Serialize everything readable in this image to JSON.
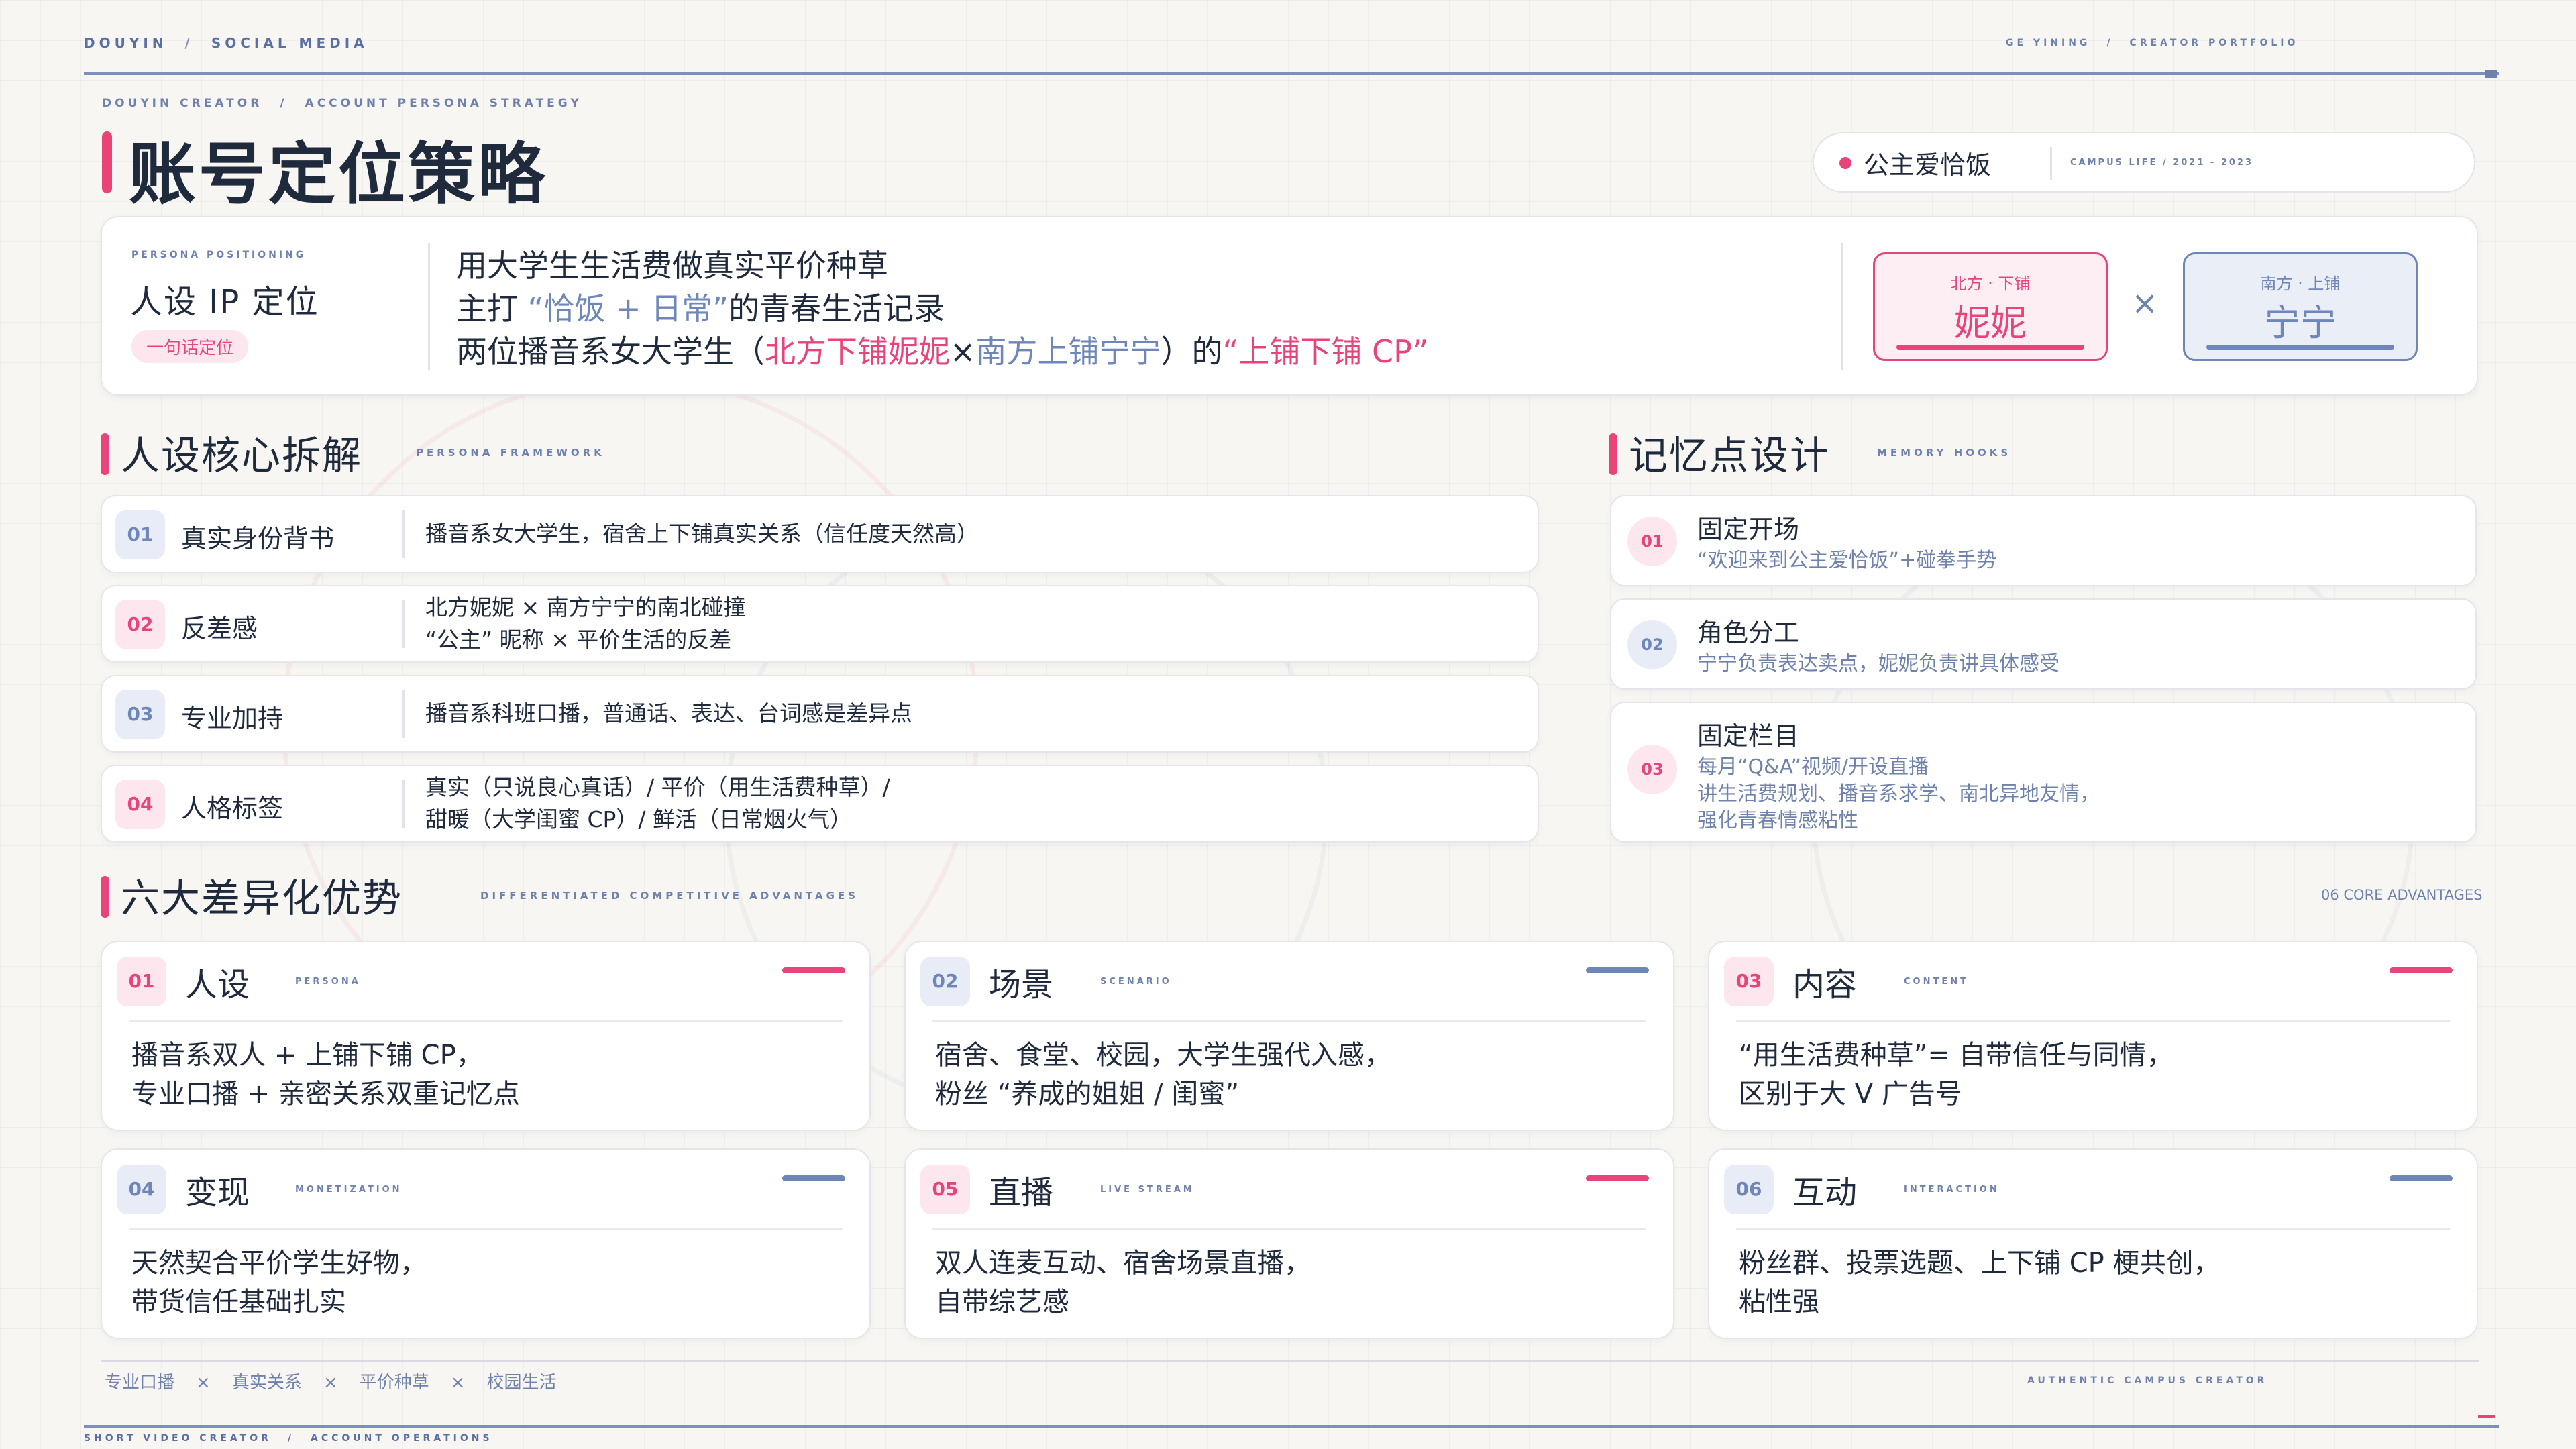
{
  "topnav": {
    "left_a": "DOUYIN",
    "left_b": "SOCIAL MEDIA",
    "right_a": "GE YINING",
    "right_b": "CREATOR PORTFOLIO",
    "sep": "/"
  },
  "crumb": {
    "a": "DOUYIN CREATOR",
    "b": "ACCOUNT PERSONA STRATEGY"
  },
  "title": "账号定位策略",
  "account": {
    "name": "公主爱恰饭",
    "meta": "CAMPUS LIFE  /  2021 - 2023"
  },
  "positioning": {
    "label_en": "PERSONA POSITIONING",
    "label_zh": "人设 IP 定位",
    "tag": "一句话定位",
    "line1": "用大学生生活费做真实平价种草",
    "line2": {
      "a": "主打 ",
      "b": "“恰饭 + 日常”",
      "c": "的青春生活记录"
    },
    "line3": {
      "a": "两位播音系女大学生（",
      "b": "北方下铺妮妮",
      "c": "×",
      "d": "南方上铺宁宁",
      "e": "）的",
      "f": "“上铺下铺 CP”"
    },
    "role_a": {
      "sub": "北方 · 下铺",
      "name": "妮妮"
    },
    "times": "×",
    "role_b": {
      "sub": "南方 · 上铺",
      "name": "宁宁"
    }
  },
  "framework": {
    "title": "人设核心拆解",
    "en": "PERSONA FRAMEWORK",
    "items": [
      {
        "num": "01",
        "name": "真实身份背书",
        "desc1": "播音系女大学生，宿舍上下铺真实关系（信任度天然高）",
        "desc2": ""
      },
      {
        "num": "02",
        "name": "反差感",
        "desc1": "北方妮妮 × 南方宁宁的南北碰撞",
        "desc2": "“公主” 昵称 × 平价生活的反差"
      },
      {
        "num": "03",
        "name": "专业加持",
        "desc1": "播音系科班口播，普通话、表达、台词感是差异点",
        "desc2": ""
      },
      {
        "num": "04",
        "name": "人格标签",
        "desc1": "真实（只说良心真话）/ 平价（用生活费种草）/",
        "desc2": "甜暖（大学闺蜜 CP）/ 鲜活（日常烟火气）"
      }
    ]
  },
  "memory": {
    "title": "记忆点设计",
    "en": "MEMORY HOOKS",
    "items": [
      {
        "num": "01",
        "title": "固定开场",
        "d1": "“欢迎来到公主爱恰饭”+碰拳手势",
        "d2": "",
        "d3": ""
      },
      {
        "num": "02",
        "title": "角色分工",
        "d1": "宁宁负责表达卖点，妮妮负责讲具体感受",
        "d2": "",
        "d3": ""
      },
      {
        "num": "03",
        "title": "固定栏目",
        "d1": "每月“Q&A”视频/开设直播",
        "d2": "讲生活费规划、播音系求学、南北异地友情，",
        "d3": "强化青春情感粘性"
      }
    ]
  },
  "advantages": {
    "title": "六大差异化优势",
    "en": "DIFFERENTIATED COMPETITIVE ADVANTAGES",
    "count": "06 CORE ADVANTAGES",
    "items": [
      {
        "num": "01",
        "zh": "人设",
        "en": "PERSONA",
        "b1": "播音系双人 + 上铺下铺 CP，",
        "b2": "专业口播 + 亲密关系双重记忆点"
      },
      {
        "num": "02",
        "zh": "场景",
        "en": "SCENARIO",
        "b1": "宿舍、食堂、校园，大学生强代入感，",
        "b2": "粉丝 “养成的姐姐 / 闺蜜”"
      },
      {
        "num": "03",
        "zh": "内容",
        "en": "CONTENT",
        "b1": "“用生活费种草”= 自带信任与同情，",
        "b2": "区别于大 V 广告号"
      },
      {
        "num": "04",
        "zh": "变现",
        "en": "MONETIZATION",
        "b1": "天然契合平价学生好物，",
        "b2": "带货信任基础扎实"
      },
      {
        "num": "05",
        "zh": "直播",
        "en": "LIVE STREAM",
        "b1": "双人连麦互动、宿舍场景直播，",
        "b2": "自带综艺感"
      },
      {
        "num": "06",
        "zh": "互动",
        "en": "INTERACTION",
        "b1": "粉丝群、投票选题、上下铺 CP 梗共创，",
        "b2": "粘性强"
      }
    ]
  },
  "footer": {
    "tags": [
      "口播",
      "真实关系",
      "平价种草",
      "校园生活"
    ],
    "tag_prefix": "专业",
    "x": "×",
    "right": "AUTHENTIC CAMPUS CREATOR",
    "bottom_a": "SHORT VIDEO CREATOR",
    "bottom_b": "ACCOUNT OPERATIONS"
  },
  "colors": {
    "accent_pink": "#e8447a",
    "accent_blue": "#6e86b8",
    "ink": "#1f2a3d"
  }
}
